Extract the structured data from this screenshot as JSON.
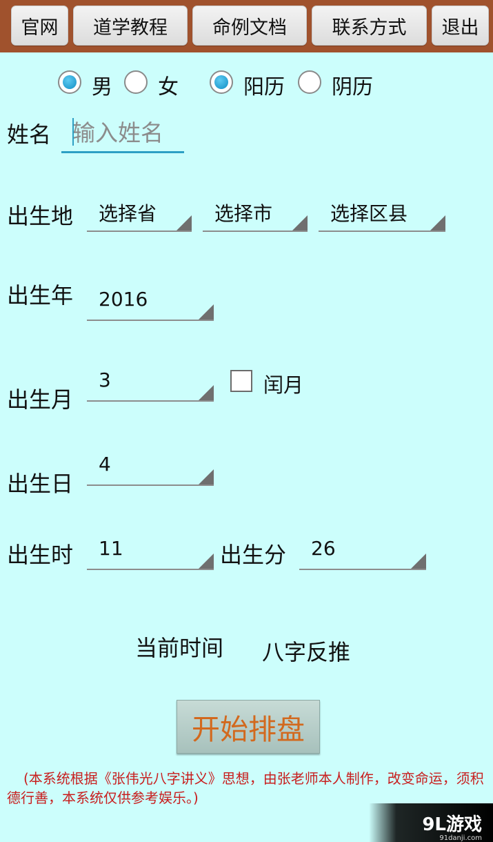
{
  "toolbar": {
    "buttons": [
      "官网",
      "道学教程",
      "命例文档",
      "联系方式",
      "退出"
    ]
  },
  "gender": {
    "male": "男",
    "female": "女",
    "selected": "男"
  },
  "calendar": {
    "solar": "阳历",
    "lunar": "阴历",
    "selected": "阳历"
  },
  "name": {
    "label": "姓名",
    "placeholder": "输入姓名",
    "value": ""
  },
  "birthplace": {
    "label": "出生地",
    "province": "选择省",
    "city": "选择市",
    "county": "选择区县"
  },
  "year": {
    "label": "出生年",
    "value": "2016"
  },
  "month": {
    "label": "出生月",
    "value": "3",
    "leap_label": "闰月",
    "leap_checked": false
  },
  "day": {
    "label": "出生日",
    "value": "4"
  },
  "hour": {
    "label": "出生时",
    "value": "11"
  },
  "minute": {
    "label": "出生分",
    "value": "26"
  },
  "actions": {
    "current_time": "当前时间",
    "bazi_reverse": "八字反推",
    "start": "开始排盘"
  },
  "note": "(本系统根据《张伟光八字讲义》思想，由张老师本人制作，改变命运，须积德行善，本系统仅供参考娱乐。)",
  "watermark": {
    "main": "9L游戏",
    "sub": "91danji.com"
  },
  "colors": {
    "background": "#ccfefc",
    "toolbar": "#a0522d",
    "accent": "#2c9fc4",
    "start_text": "#d2691e",
    "note_text": "#c81e1e"
  }
}
